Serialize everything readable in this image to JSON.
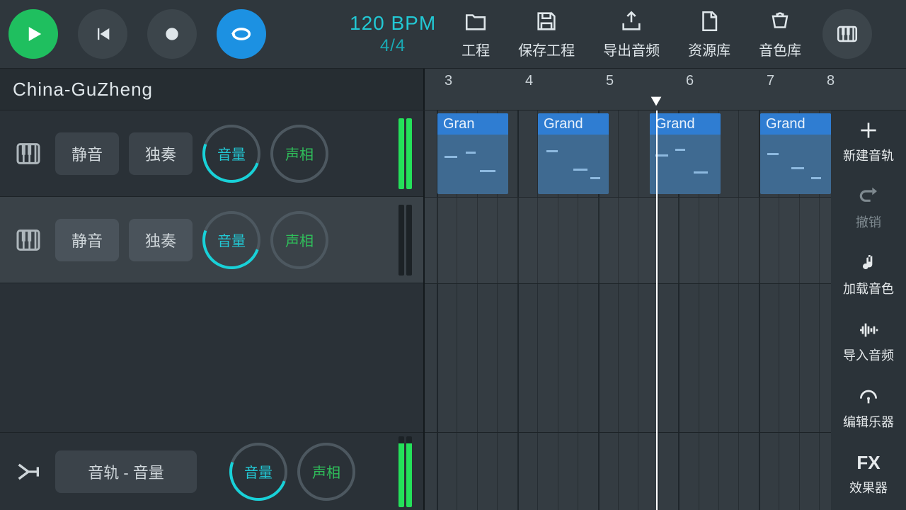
{
  "tempo": {
    "bpm": "120 BPM",
    "signature": "4/4"
  },
  "menu": {
    "project": "工程",
    "save": "保存工程",
    "export": "导出音频",
    "library": "资源库",
    "sounds": "音色库"
  },
  "track_header": {
    "name": "China-GuZheng"
  },
  "ruler": {
    "bars": [
      "3",
      "4",
      "5",
      "6",
      "7",
      "8"
    ]
  },
  "tracks": [
    {
      "mute": "静音",
      "solo": "独奏",
      "volume": "音量",
      "pan": "声相",
      "meter": 1.0
    },
    {
      "mute": "静音",
      "solo": "独奏",
      "volume": "音量",
      "pan": "声相",
      "meter": 0.0
    }
  ],
  "master": {
    "label": "音轨 - 音量",
    "volume": "音量",
    "pan": "声相",
    "meter": 0.9
  },
  "clips": [
    {
      "label": "Gran"
    },
    {
      "label": "Grand"
    },
    {
      "label": "Grand"
    },
    {
      "label": "Grand"
    }
  ],
  "sidebar": {
    "new_track": "新建音轨",
    "undo": "撤销",
    "load_sound": "加载音色",
    "import_audio": "导入音频",
    "edit_instrument": "编辑乐器",
    "fx_label": "FX",
    "fx": "效果器"
  }
}
